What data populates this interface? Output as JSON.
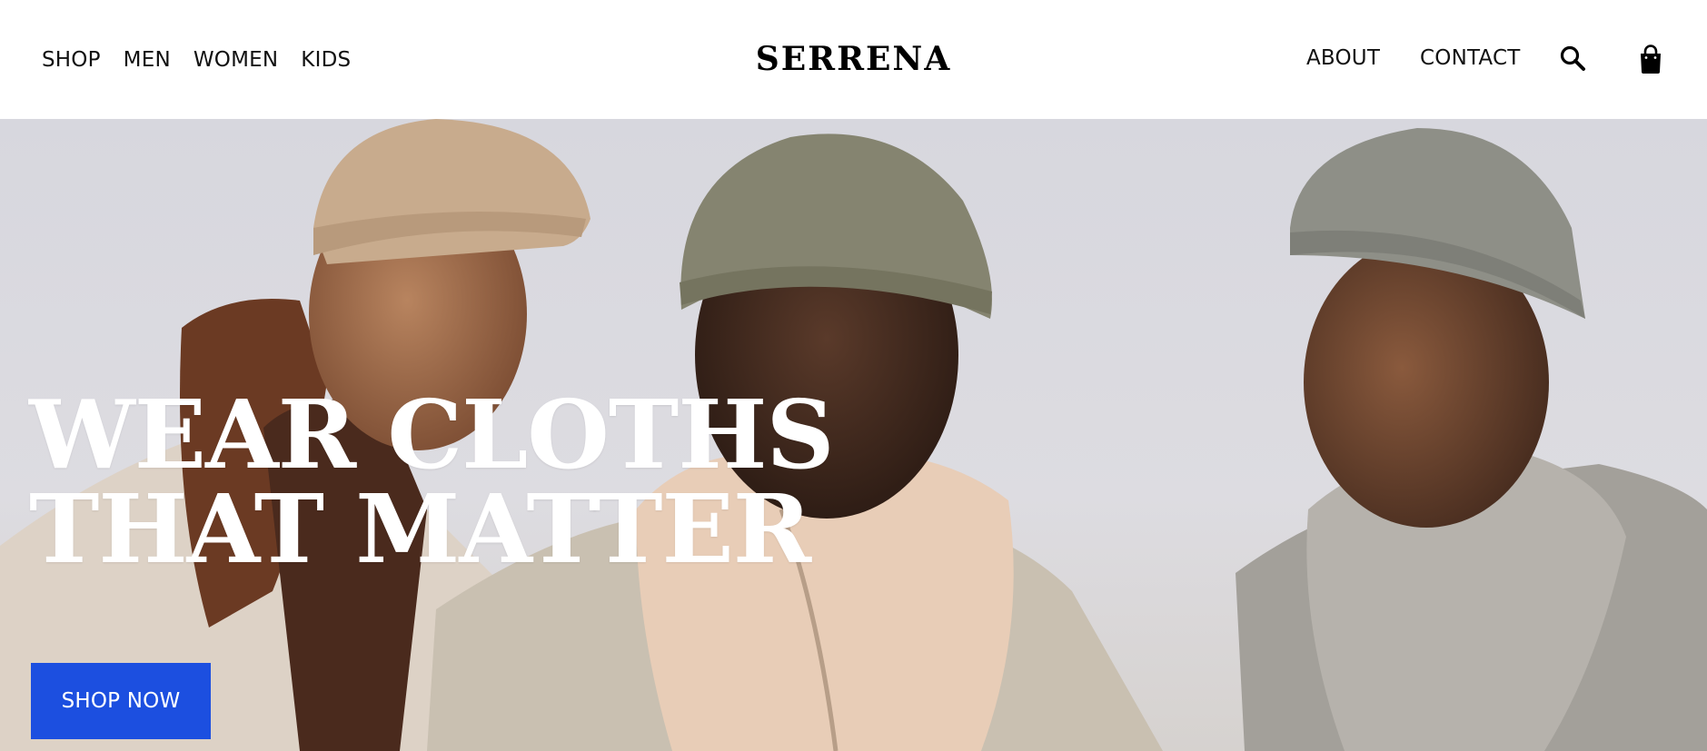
{
  "nav": {
    "left_links": [
      "SHOP",
      "MEN",
      "WOMEN",
      "KIDS"
    ],
    "brand": "SERRENA",
    "about": "ABOUT",
    "contact": "CONTACT",
    "search_icon": "search-icon",
    "cart_icon": "shopping-bag-icon"
  },
  "hero": {
    "headline_line1": "WEAR CLOTHS",
    "headline_line2": "THAT MATTER",
    "cta_label": "SHOP NOW",
    "image_subject": "photo"
  },
  "colors": {
    "cta_background": "#1c4fe0",
    "headline_text": "#ffffff",
    "nav_background": "#ffffff"
  }
}
